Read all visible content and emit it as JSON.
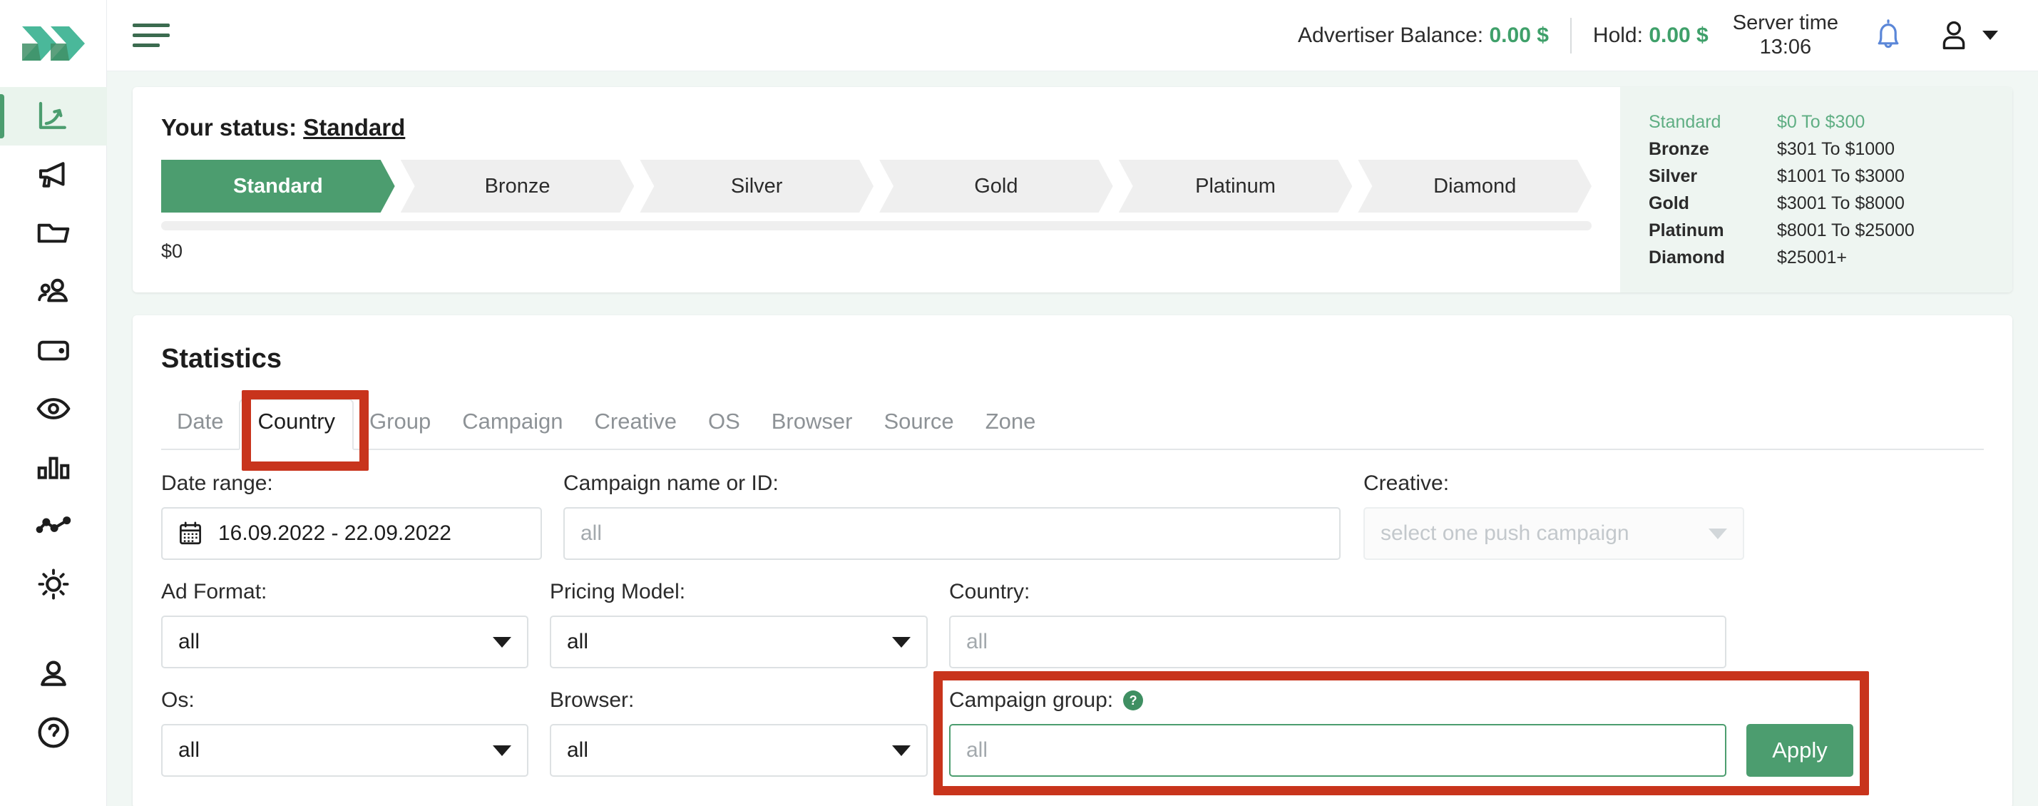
{
  "topbar": {
    "menu_icon": "hamburger-menu-icon",
    "advertiser_balance_label": "Advertiser Balance:",
    "advertiser_balance_value": "0.00 $",
    "hold_label": "Hold:",
    "hold_value": "0.00 $",
    "server_time_label": "Server time",
    "server_time_value": "13:06",
    "bell_icon": "notification-bell-icon",
    "user_icon": "user-account-icon",
    "caret_icon": "chevron-down-icon"
  },
  "sidebar": {
    "logo": "double-chevron-logo",
    "items": [
      {
        "name": "statistics",
        "icon": "growth-arrow-icon",
        "active": true
      },
      {
        "name": "campaigns",
        "icon": "megaphone-icon",
        "active": false
      },
      {
        "name": "folders",
        "icon": "folder-icon",
        "active": false
      },
      {
        "name": "audience",
        "icon": "users-group-icon",
        "active": false
      },
      {
        "name": "billing",
        "icon": "wallet-icon",
        "active": false
      },
      {
        "name": "tracking",
        "icon": "eye-icon",
        "active": false
      },
      {
        "name": "reports",
        "icon": "bar-chart-icon",
        "active": false
      },
      {
        "name": "trends",
        "icon": "line-chart-icon",
        "active": false
      },
      {
        "name": "theme",
        "icon": "sun-icon",
        "active": false
      },
      {
        "name": "profile",
        "icon": "person-icon",
        "active": false
      },
      {
        "name": "support",
        "icon": "question-circle-icon",
        "active": false
      }
    ]
  },
  "status": {
    "title_label": "Your status:",
    "title_value": "Standard",
    "tiers": [
      "Standard",
      "Bronze",
      "Silver",
      "Gold",
      "Platinum",
      "Diamond"
    ],
    "current_tier": "Standard",
    "progress_amount": "$0",
    "progress_percent": 0,
    "legend": [
      {
        "name": "Standard",
        "range": "$0 To $300",
        "current": true
      },
      {
        "name": "Bronze",
        "range": "$301 To $1000",
        "current": false
      },
      {
        "name": "Silver",
        "range": "$1001 To $3000",
        "current": false
      },
      {
        "name": "Gold",
        "range": "$3001 To $8000",
        "current": false
      },
      {
        "name": "Platinum",
        "range": "$8001 To $25000",
        "current": false
      },
      {
        "name": "Diamond",
        "range": "$25001+",
        "current": false
      }
    ]
  },
  "statistics": {
    "title": "Statistics",
    "tabs": [
      {
        "label": "Date",
        "active": false
      },
      {
        "label": "Country",
        "active": true
      },
      {
        "label": "Group",
        "active": false
      },
      {
        "label": "Campaign",
        "active": false
      },
      {
        "label": "Creative",
        "active": false
      },
      {
        "label": "OS",
        "active": false
      },
      {
        "label": "Browser",
        "active": false
      },
      {
        "label": "Source",
        "active": false
      },
      {
        "label": "Zone",
        "active": false
      }
    ],
    "filters": {
      "date_range_label": "Date range:",
      "date_range_value": "16.09.2022 - 22.09.2022",
      "campaign_label": "Campaign name or ID:",
      "campaign_placeholder": "all",
      "creative_label": "Creative:",
      "creative_placeholder": "select one push campaign",
      "ad_format_label": "Ad Format:",
      "ad_format_value": "all",
      "pricing_model_label": "Pricing Model:",
      "pricing_model_value": "all",
      "country_label": "Country:",
      "country_placeholder": "all",
      "os_label": "Os:",
      "os_value": "all",
      "browser_label": "Browser:",
      "browser_value": "all",
      "campaign_group_label": "Campaign group:",
      "campaign_group_help": "?",
      "campaign_group_placeholder": "all",
      "apply_label": "Apply"
    }
  },
  "colors": {
    "accent_green": "#4c9d6f",
    "light_green_bg": "#eaf4ed",
    "page_bg": "#f1f7f4",
    "highlight_red": "#c8341c",
    "bell_blue": "#5b87d8",
    "muted_text": "#8d9296"
  }
}
